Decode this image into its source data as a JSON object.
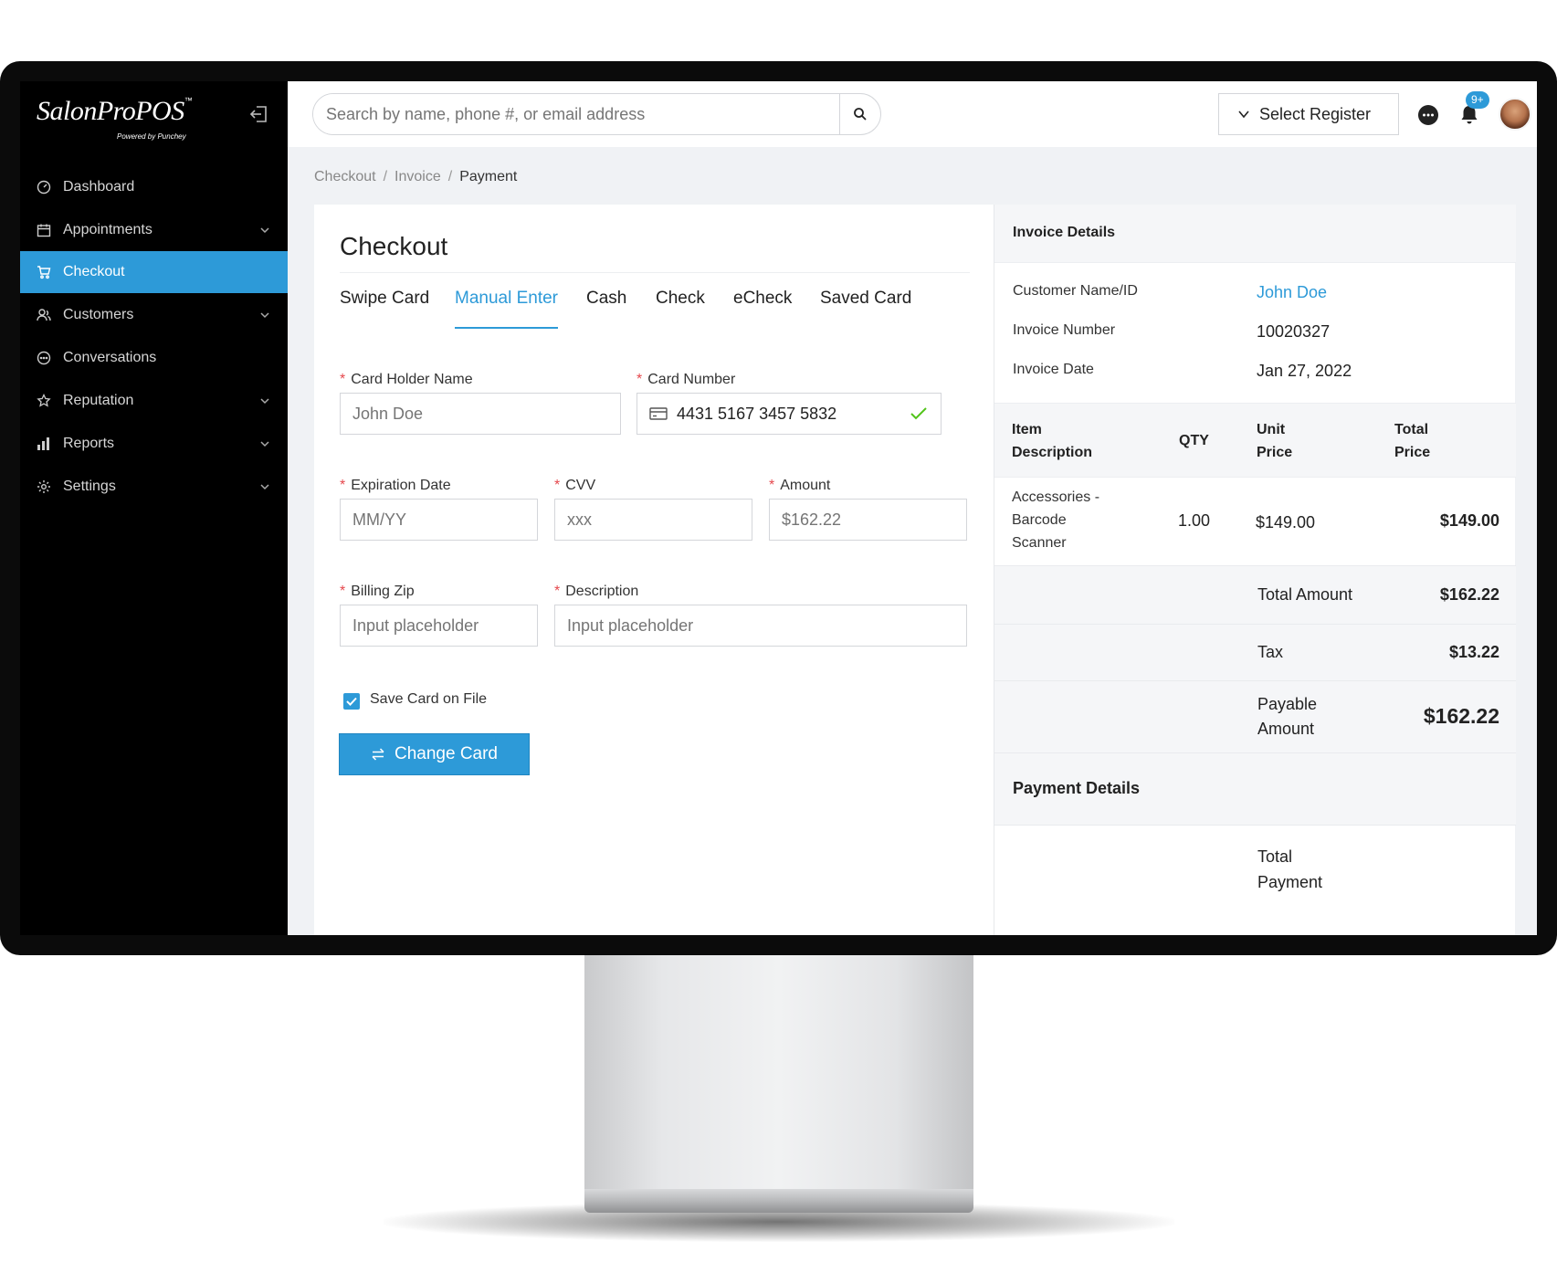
{
  "app": {
    "logo_text": "SalonProPOS",
    "logo_tm": "™",
    "logo_sub": "Powered by Punchey"
  },
  "sidebar": {
    "items": [
      {
        "label": "Dashboard",
        "icon": "dashboard-icon",
        "has_submenu": false,
        "active": false
      },
      {
        "label": "Appointments",
        "icon": "calendar-icon",
        "has_submenu": true,
        "active": false
      },
      {
        "label": "Checkout",
        "icon": "cart-icon",
        "has_submenu": false,
        "active": true
      },
      {
        "label": "Customers",
        "icon": "customers-icon",
        "has_submenu": true,
        "active": false
      },
      {
        "label": "Conversations",
        "icon": "chat-bubble-icon",
        "has_submenu": false,
        "active": false
      },
      {
        "label": "Reputation",
        "icon": "star-icon",
        "has_submenu": true,
        "active": false
      },
      {
        "label": "Reports",
        "icon": "bar-chart-icon",
        "has_submenu": true,
        "active": false
      },
      {
        "label": "Settings",
        "icon": "gear-icon",
        "has_submenu": true,
        "active": false
      }
    ]
  },
  "header": {
    "search_placeholder": "Search by name, phone #, or email address",
    "register_label": "Select Register",
    "notification_badge": "9+"
  },
  "breadcrumb": {
    "items": [
      "Checkout",
      "Invoice",
      "Payment"
    ],
    "separator": "/"
  },
  "checkout": {
    "title": "Checkout",
    "tabs": [
      "Swipe Card",
      "Manual Enter",
      "Cash",
      "Check",
      "eCheck",
      "Saved Card"
    ],
    "active_tab": "Manual Enter",
    "fields": {
      "card_holder": {
        "label": "Card Holder Name",
        "value": "",
        "placeholder": "John Doe"
      },
      "card_number": {
        "label": "Card Number",
        "value": "4431 5167 3457 5832"
      },
      "expiration": {
        "label": "Expiration Date",
        "value": "",
        "placeholder": "MM/YY"
      },
      "cvv": {
        "label": "CVV",
        "value": "",
        "placeholder": "xxx"
      },
      "amount": {
        "label": "Amount",
        "value": "",
        "placeholder": "$162.22"
      },
      "billing_zip": {
        "label": "Billing Zip",
        "value": "",
        "placeholder": "Input placeholder"
      },
      "description": {
        "label": "Description",
        "value": "",
        "placeholder": "Input placeholder"
      }
    },
    "save_card_label": "Save Card on File",
    "save_card_checked": true,
    "change_card_label": "Change Card",
    "required_marker": "*"
  },
  "invoice": {
    "title": "Invoice Details",
    "customer_label": "Customer Name/ID",
    "customer_value": "John Doe",
    "number_label": "Invoice Number",
    "number_value": "10020327",
    "date_label": "Invoice Date",
    "date_value": "Jan 27, 2022",
    "table_headers": {
      "item_line1": "Item",
      "item_line2": "Description",
      "qty": "QTY",
      "unit_line1": "Unit",
      "unit_line2": "Price",
      "total_line1": "Total",
      "total_line2": "Price"
    },
    "rows": [
      {
        "desc_line1": "Accessories -",
        "desc_line2": "Barcode",
        "desc_line3": "Scanner",
        "qty": "1.00",
        "unit_price": "$149.00",
        "total_price": "$149.00"
      }
    ],
    "total_amount_label": "Total Amount",
    "total_amount_value": "$162.22",
    "tax_label": "Tax",
    "tax_value": "$13.22",
    "payable_line1": "Payable",
    "payable_line2": "Amount",
    "payable_value": "$162.22",
    "payment_details_title": "Payment Details",
    "total_payment_line1": "Total",
    "total_payment_line2": "Payment"
  },
  "colors": {
    "accent": "#2d9ad8",
    "sidebar_bg": "#000000",
    "required": "#e5484d",
    "success": "#52c41a"
  }
}
